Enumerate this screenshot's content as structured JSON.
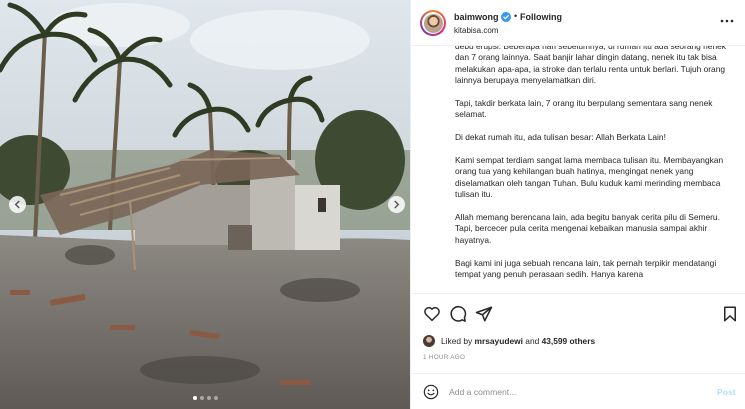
{
  "post": {
    "username": "baimwong",
    "separator": "•",
    "follow_status": "Following",
    "location": "kitabisa.com"
  },
  "caption": {
    "paragraphs": [
      "debu erupsi. Beberapa hari sebelumnya, di rumah itu ada seorang nenek dan 7 orang lainnya. Saat banjir lahar dingin datang, nenek itu tak bisa melakukan apa-apa, ia stroke dan terlalu renta untuk berlari. Tujuh orang lainnya berupaya menyelamatkan diri.",
      "Tapi, takdir berkata lain, 7 orang itu berpulang sementara sang nenek selamat.",
      "Di dekat rumah itu, ada tulisan besar: Allah Berkata Lain!",
      "Kami sempat terdiam sangat lama membaca tulisan itu. Membayangkan orang tua yang kehilangan buah hatinya, mengingat nenek yang diselamatkan oleh tangan Tuhan. Bulu kuduk kami merinding membaca tulisan itu.",
      "Allah memang berencana lain, ada begitu banyak cerita pilu di Semeru. Tapi, bercecer pula cerita mengenai kebaikan manusia sampai akhir hayatnya.",
      "Bagi kami ini juga sebuah rencana lain, tak pernah terpikir mendatangi tempat yang penuh perasaan sedih. Hanya karena"
    ]
  },
  "likes": {
    "prefix": "Liked by",
    "user": "mrsayudewi",
    "conjunction": "and",
    "others": "43,599 others"
  },
  "time_ago": "1 HOUR AGO",
  "comment": {
    "placeholder": "Add a comment...",
    "post_label": "Post"
  },
  "carousel": {
    "slide_count": 4,
    "active_index": 0
  },
  "colors": {
    "verified": "#3897f0",
    "post_disabled": "#b2dffc",
    "muted": "#8e8e8e"
  },
  "icons": [
    "chevron-left-icon",
    "chevron-right-icon",
    "verified-icon",
    "more-options-icon",
    "heart-icon",
    "comment-icon",
    "share-icon",
    "bookmark-icon",
    "emoji-icon"
  ]
}
